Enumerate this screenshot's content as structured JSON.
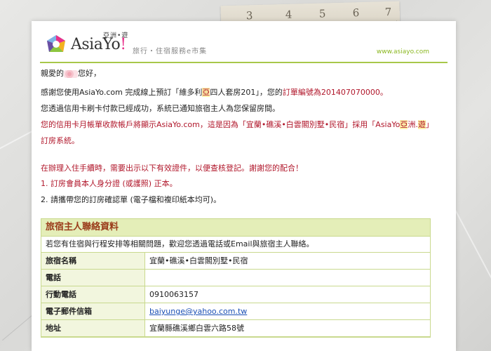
{
  "brand": {
    "name": "AsiaYo",
    "bang": "!",
    "small_cn": "亞洲•遊",
    "tagline": "旅行・住宿服務e市集",
    "url": "www.asiayo.com"
  },
  "ruler": {
    "numbers": [
      "3",
      "4",
      "5",
      "6",
      "7"
    ]
  },
  "letter": {
    "greeting_pre": "親愛的",
    "greeting_post": "您好，",
    "p1_a": "感謝您使用AsiaYo.com 完成線上預訂「維多利",
    "p1_hl": "亞",
    "p1_b": "四人套房201」，您的",
    "p1_red": "訂單編號為201407070000。",
    "p2": "您透過信用卡刷卡付款已經成功，系統已通知旅宿主人為您保留房間。",
    "p3_a": "您的信用卡月帳單收款帳戶將顯示AsiaYo.com，這是因為「宜蘭•礁溪•白雲閣別墅•民宿」採用「AsiaYo",
    "p3_hl1": "亞",
    "p3_mid": "洲.",
    "p3_hl2": "遊",
    "p3_end": "」",
    "p3_line2": "訂房系統。",
    "notice": "在辦理入住手續時，需要出示以下有效證件，以便查核登記。謝謝您的配合！",
    "item1": "1. 訂房會員本人身分證 (或護照) 正本。",
    "item2": "2. 請攜帶您的訂房確認單 (電子檔和複印紙本均可)。"
  },
  "contact_table": {
    "title": "旅宿主人聯絡資料",
    "note": "若您有住宿與行程安排等相關問題，歡迎您透過電話或Email與旅宿主人聯絡。",
    "rows": [
      {
        "label": "旅宿名稱",
        "value": "宜蘭•礁溪•白雲閣別墅•民宿"
      },
      {
        "label": "電話",
        "value": ""
      },
      {
        "label": "行動電話",
        "value": "0910063157"
      },
      {
        "label": "電子郵件信箱",
        "value": "baiyunge@yahoo.com.tw"
      },
      {
        "label": "地址",
        "value": "宜蘭縣礁溪鄉白雲六路58號"
      }
    ]
  },
  "colors": {
    "accent_green": "#a8c84a",
    "alert_red": "#b0162a",
    "table_header": "#e4eeb8",
    "link": "#1a4fb4"
  }
}
